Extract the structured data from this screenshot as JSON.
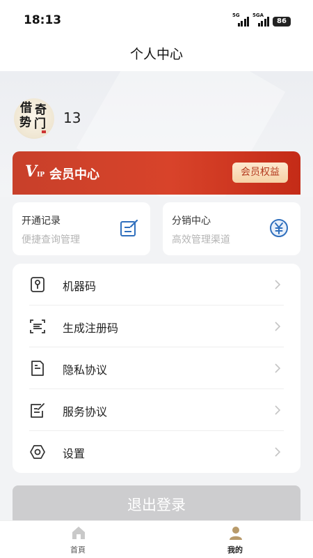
{
  "status_bar": {
    "time": "18:13",
    "signal1_label": "5G",
    "signal2_label": "5GA",
    "battery": "86"
  },
  "header": {
    "title": "个人中心"
  },
  "profile": {
    "avatar_chars": [
      "借",
      "奇",
      "势",
      "门"
    ],
    "username": "13"
  },
  "vip": {
    "logo_v": "V",
    "logo_ip": "IP",
    "title": "会员中心",
    "benefit_label": "会员权益",
    "color_start": "#c8402a",
    "color_end": "#c42b17"
  },
  "quick_cards": [
    {
      "title": "开通记录",
      "subtitle": "便捷查询管理",
      "icon": "edit-note-icon"
    },
    {
      "title": "分销中心",
      "subtitle": "高效管理渠道",
      "icon": "yuan-icon"
    }
  ],
  "menu": [
    {
      "label": "机器码",
      "icon": "key-icon"
    },
    {
      "label": "生成注册码",
      "icon": "scan-code-icon"
    },
    {
      "label": "隐私协议",
      "icon": "privacy-doc-icon"
    },
    {
      "label": "服务协议",
      "icon": "service-doc-icon"
    },
    {
      "label": "设置",
      "icon": "settings-icon"
    }
  ],
  "logout_label": "退出登录",
  "tabbar": [
    {
      "label": "首頁",
      "icon": "home-icon",
      "active": false
    },
    {
      "label": "我的",
      "icon": "user-icon",
      "active": true
    }
  ],
  "colors": {
    "accent": "#c8402a",
    "vip_badge_bg": "#fde9cf",
    "tab_active": "#b89a6a"
  }
}
